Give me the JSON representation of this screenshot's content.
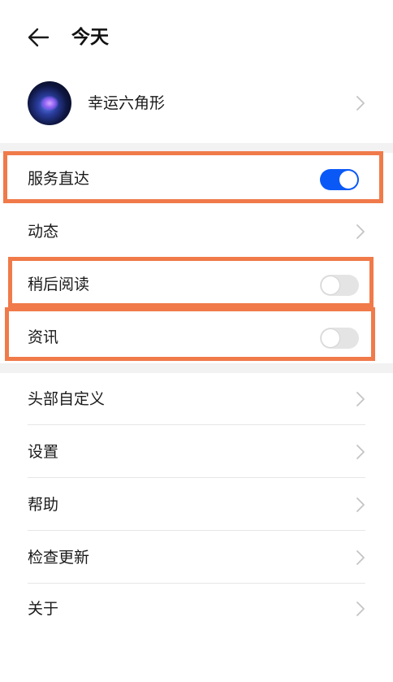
{
  "header": {
    "title": "今天",
    "back_icon": "arrow-left-icon"
  },
  "profile": {
    "name": "幸运六角形",
    "avatar": "avatar-image"
  },
  "toggles": [
    {
      "label": "服务直达",
      "checked": true
    },
    {
      "label": "稍后阅读",
      "checked": false
    },
    {
      "label": "资讯",
      "checked": false
    }
  ],
  "rows": {
    "dynamic": "动态",
    "header_custom": "头部自定义",
    "settings": "设置",
    "help": "帮助",
    "check_update": "检查更新",
    "about": "关于"
  },
  "colors": {
    "accent": "#0a59f7",
    "highlight_border": "#f07a4a",
    "section_gap": "#f2f2f2",
    "toggle_off": "#e4e4e4"
  }
}
